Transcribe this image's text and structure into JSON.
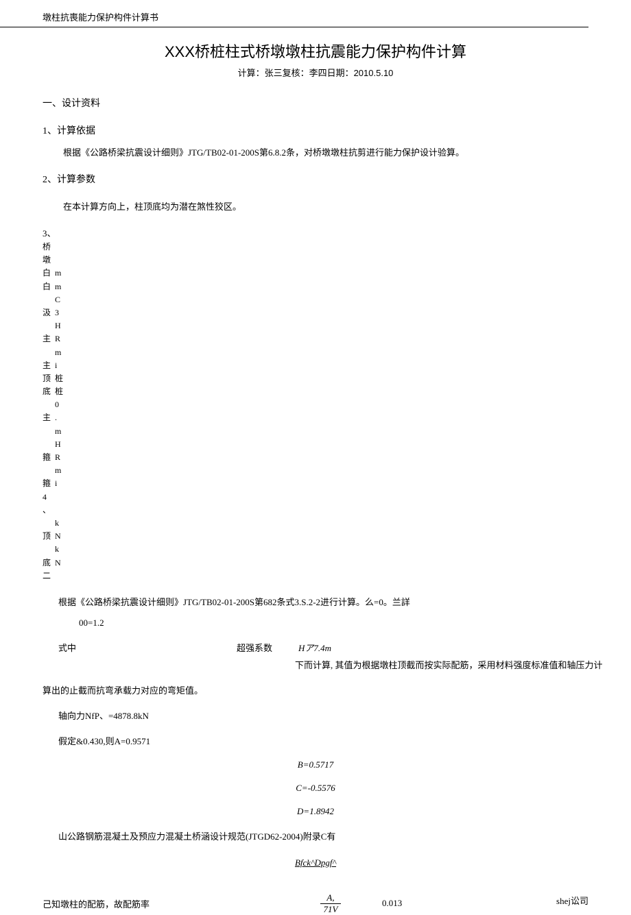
{
  "header_bar": "墩柱抗喪能力保护构件计算书",
  "title": "XXX桥桩柱式桥墩墩柱抗震能力保护构件计算",
  "subtitle": "计算：张三复核：李四日期：2010.5.10",
  "sec1": "一、设计资料",
  "sec1_1": "1、计算依据",
  "sec1_1_text": "根据《公路桥梁抗震设计细则》JTG/TB02-01-200S第6.8.2条，对桥墩墩柱抗剪进行能力保护设计验算。",
  "sec1_2": "2、计算参数",
  "sec1_2_text": "在本计算方向上，柱顶底均为潜在煞性狡区。",
  "sec1_3": "3、",
  "params": [
    {
      "a": "桥墩",
      "b": ""
    },
    {
      "a": "白",
      "b": "m"
    },
    {
      "a": "白",
      "b": "m"
    },
    {
      "a": "",
      "b": "C"
    },
    {
      "a": "汲",
      "b": "3"
    },
    {
      "a": "",
      "b": "H"
    },
    {
      "a": "主",
      "b": "R"
    },
    {
      "a": "",
      "b": "m"
    },
    {
      "a": "主",
      "b": "i"
    },
    {
      "a": "顶",
      "b": "桩"
    },
    {
      "a": "底",
      "b": "桩"
    },
    {
      "a": "",
      "b": "0"
    },
    {
      "a": "主",
      "b": "."
    },
    {
      "a": "",
      "b": "m"
    },
    {
      "a": "",
      "b": "H"
    },
    {
      "a": "箍",
      "b": "R"
    },
    {
      "a": "",
      "b": "m"
    },
    {
      "a": "箍",
      "b": "i"
    },
    {
      "a": "4",
      "b": ""
    },
    {
      "a": "、",
      "b": ""
    },
    {
      "a": "",
      "b": "k"
    },
    {
      "a": "顶",
      "b": "N"
    },
    {
      "a": "",
      "b": "k"
    },
    {
      "a": "底",
      "b": "N"
    },
    {
      "a": "二",
      "b": ""
    }
  ],
  "body1": "根据《公路桥梁抗震设计细则》JTG/TB02-01-200S第682条式3.S.2-2进行计算。么=0。兰詳",
  "body2": "00=1.2",
  "row_label1": "式中",
  "row_label2": "超强系数",
  "row_val": "Hア7.4m",
  "row_desc": "下而计算, 其值为根据墩柱顶截而按实际配筋，采用材料强度标准值和轴压力计",
  "body3": "算出的止截而抗弯承载力对应的弯矩值。",
  "body4": "轴向力NfP、=4878.8kN",
  "body5": "假定&0.430,则A=0.9571",
  "eq_b": "B=0.5717",
  "eq_c": "C=-0.5576",
  "eq_d": "D=1.8942",
  "body6": "山公路钢筋混凝土及预应力混凝土桥涵设计规范(JTGD62-2004)附录C有",
  "eq_main": "Bfck^Dpgf^",
  "frac_label": "己知墩柱的配筋，故配筋率",
  "frac_num": "A,",
  "frac_den": "71V",
  "frac_val": "0.013",
  "footer": "shej讼司"
}
